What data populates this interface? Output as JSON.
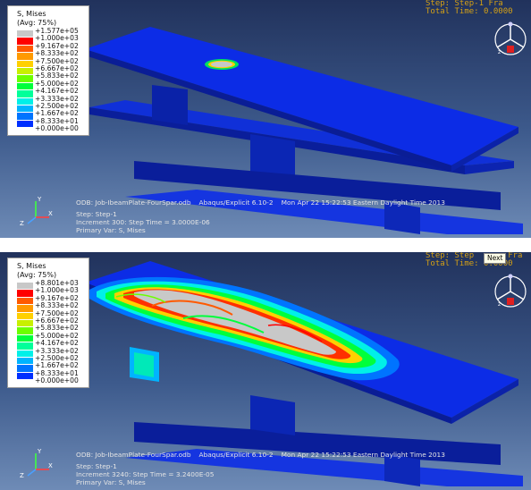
{
  "legend_colors": [
    "#c8c8c8",
    "#ff0000",
    "#ff5a00",
    "#ff9a00",
    "#ffd000",
    "#c8f000",
    "#6cff00",
    "#00ff3c",
    "#00ff9a",
    "#00f0e8",
    "#00b4ff",
    "#0074ff",
    "#0030ff",
    "#00009e"
  ],
  "panels": [
    {
      "legend": {
        "title": "S, Mises",
        "subtitle": "(Avg: 75%)",
        "values": [
          "+1.577e+05",
          "+1.000e+03",
          "+9.167e+02",
          "+8.333e+02",
          "+7.500e+02",
          "+6.667e+02",
          "+5.833e+02",
          "+5.000e+02",
          "+4.167e+02",
          "+3.333e+02",
          "+2.500e+02",
          "+1.667e+02",
          "+8.333e+01",
          "+0.000e+00"
        ]
      },
      "step_info": {
        "line1": "Step: Step-1   Fra",
        "line2": "Total Time: 0.0000"
      },
      "info": {
        "odb": "ODB: Job-IbeamPlate-FourSpar.odb",
        "version": "Abaqus/Explicit 6.10-2",
        "date": "Mon Apr 22 15:22:53 Eastern Daylight Time 2013",
        "step": "Step: Step-1",
        "increment": "Increment      300: Step Time =    3.0000E-06",
        "primary_var": "Primary Var: S, Mises"
      },
      "axes": {
        "x": "X",
        "y": "Y",
        "z": "Z"
      }
    },
    {
      "legend": {
        "title": "S, Mises",
        "subtitle": "(Avg: 75%)",
        "values": [
          "+8.801e+03",
          "+1.000e+03",
          "+9.167e+02",
          "+8.333e+02",
          "+7.500e+02",
          "+6.667e+02",
          "+5.833e+02",
          "+5.000e+02",
          "+4.167e+02",
          "+3.333e+02",
          "+2.500e+02",
          "+1.667e+02",
          "+8.333e+01",
          "+0.000e+00"
        ]
      },
      "step_info": {
        "line1": "Step: Step",
        "line1_suffix": "Fra",
        "line2": "Total Time: 0.0000"
      },
      "tooltip": "Next",
      "info": {
        "odb": "ODB: Job-IbeamPlate-FourSpar.odb",
        "version": "Abaqus/Explicit 6.10-2",
        "date": "Mon Apr 22 15:22:53 Eastern Daylight Time 2013",
        "step": "Step: Step-1",
        "increment": "Increment     3240: Step Time =    3.2400E-05",
        "primary_var": "Primary Var: S, Mises"
      },
      "axes": {
        "x": "X",
        "y": "Y",
        "z": "Z"
      }
    }
  ]
}
